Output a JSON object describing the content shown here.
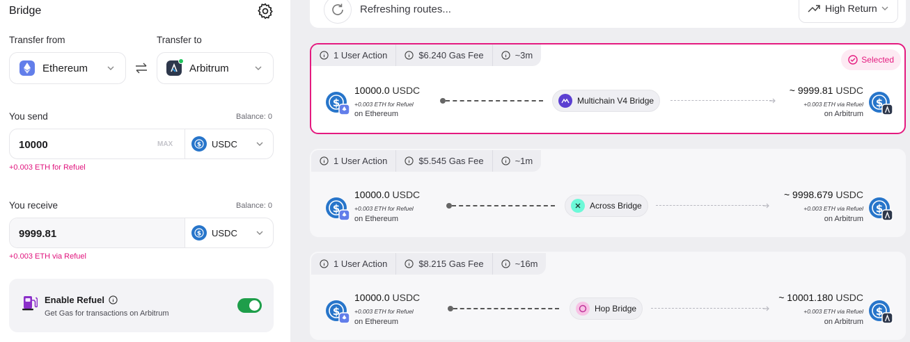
{
  "left": {
    "title": "Bridge",
    "transfer_from_label": "Transfer from",
    "transfer_to_label": "Transfer to",
    "from_chain": "Ethereum",
    "to_chain": "Arbitrum",
    "send": {
      "label": "You send",
      "balance": "Balance: 0",
      "value": "10000",
      "max_label": "MAX",
      "token": "USDC",
      "refuel_note": "+0.003 ETH for Refuel"
    },
    "receive": {
      "label": "You receive",
      "balance": "Balance: 0",
      "value": "9999.81",
      "token": "USDC",
      "refuel_note": "+0.003 ETH via Refuel"
    },
    "refuel_box": {
      "title": "Enable Refuel",
      "subtitle": "Get Gas for transactions on Arbitrum",
      "enabled": true
    }
  },
  "top_bar": {
    "status": "Refreshing routes...",
    "sort_label": "High Return"
  },
  "routes": [
    {
      "actions": "1 User Action",
      "gas": "$6.240 Gas Fee",
      "time": "~3m",
      "selected": true,
      "selected_label": "Selected",
      "send_amount": "10000.0",
      "send_token": "USDC",
      "send_refuel": "+0.003 ETH for Refuel",
      "send_chain": "on Ethereum",
      "bridge": "Multichain V4 Bridge",
      "receive_amount": "~ 9999.81",
      "receive_token": "USDC",
      "receive_refuel": "+0.003 ETH via Refuel",
      "receive_chain": "on Arbitrum"
    },
    {
      "actions": "1 User Action",
      "gas": "$5.545 Gas Fee",
      "time": "~1m",
      "selected": false,
      "send_amount": "10000.0",
      "send_token": "USDC",
      "send_refuel": "+0.003 ETH for Refuel",
      "send_chain": "on Ethereum",
      "bridge": "Across Bridge",
      "receive_amount": "~ 9998.679",
      "receive_token": "USDC",
      "receive_refuel": "+0.003 ETH via Refuel",
      "receive_chain": "on Arbitrum"
    },
    {
      "actions": "1 User Action",
      "gas": "$8.215 Gas Fee",
      "time": "~16m",
      "selected": false,
      "send_amount": "10000.0",
      "send_token": "USDC",
      "send_refuel": "+0.003 ETH for Refuel",
      "send_chain": "on Ethereum",
      "bridge": "Hop Bridge",
      "receive_amount": "~ 10001.180",
      "receive_token": "USDC",
      "receive_refuel": "+0.003 ETH via Refuel",
      "receive_chain": "on Arbitrum"
    }
  ],
  "colors": {
    "accent": "#e41a7f",
    "toggle_on": "#1e9e4a",
    "usdc": "#2775ca",
    "ethereum": "#627eea",
    "arbitrum": "#2d374b"
  }
}
